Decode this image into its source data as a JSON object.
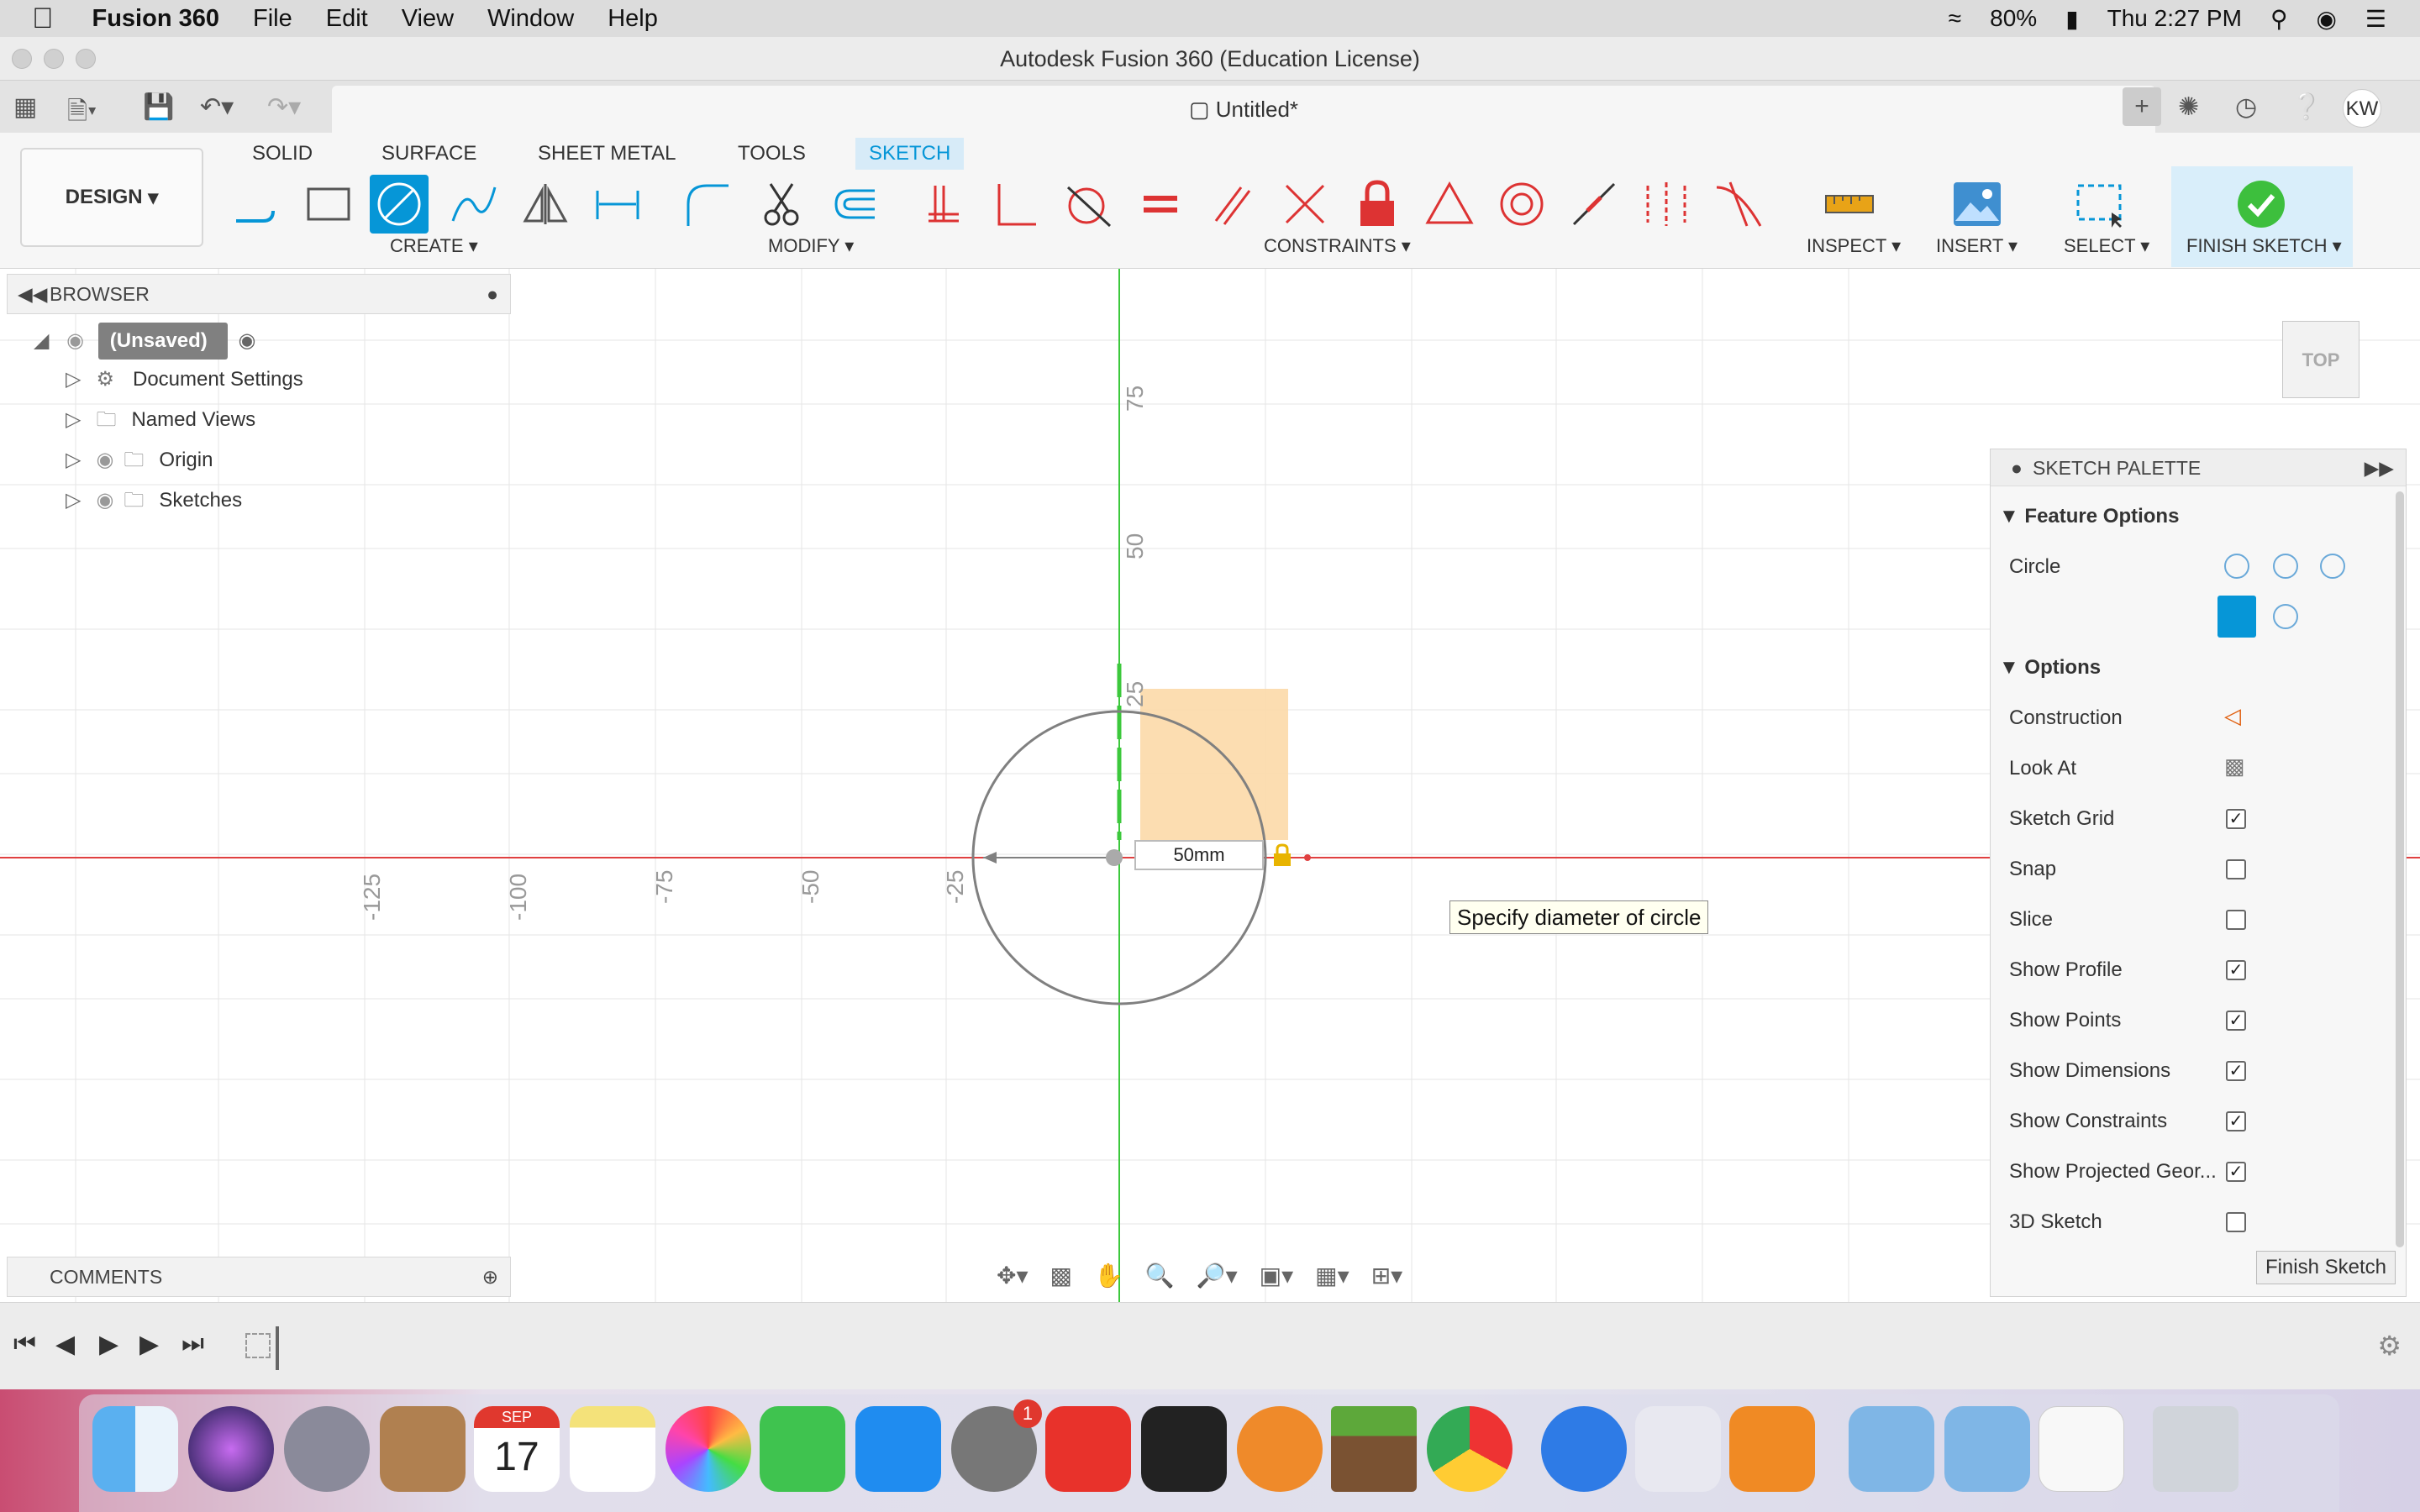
{
  "menubar": {
    "app_name": "Fusion 360",
    "items": [
      "File",
      "Edit",
      "View",
      "Window",
      "Help"
    ],
    "battery": "80%",
    "clock": "Thu 2:27 PM",
    "user_initials": "KW"
  },
  "window": {
    "title": "Autodesk Fusion 360 (Education License)",
    "doc_tab": "Untitled*"
  },
  "ribbon": {
    "workspace": "DESIGN",
    "tabs": [
      "SOLID",
      "SURFACE",
      "SHEET METAL",
      "TOOLS",
      "SKETCH"
    ],
    "active_tab": "SKETCH",
    "groups": {
      "create": "CREATE",
      "modify": "MODIFY",
      "constraints": "CONSTRAINTS",
      "inspect": "INSPECT",
      "insert": "INSERT",
      "select": "SELECT",
      "finish": "FINISH SKETCH"
    }
  },
  "browser": {
    "header": "BROWSER",
    "root": "(Unsaved)",
    "items": [
      "Document Settings",
      "Named Views",
      "Origin",
      "Sketches"
    ]
  },
  "canvas": {
    "x_ticks": [
      "-125",
      "-100",
      "-75",
      "-50",
      "-25"
    ],
    "y_ticks": [
      "75",
      "50",
      "25"
    ],
    "dimension_value": "50mm",
    "tooltip": "Specify diameter of circle",
    "viewcube_label": "TOP"
  },
  "palette": {
    "title": "SKETCH PALETTE",
    "feature_options": "Feature Options",
    "circle_label": "Circle",
    "options": "Options",
    "rows": [
      {
        "label": "Construction",
        "kind": "icon"
      },
      {
        "label": "Look At",
        "kind": "icon"
      },
      {
        "label": "Sketch Grid",
        "checked": true
      },
      {
        "label": "Snap",
        "checked": false
      },
      {
        "label": "Slice",
        "checked": false
      },
      {
        "label": "Show Profile",
        "checked": true
      },
      {
        "label": "Show Points",
        "checked": true
      },
      {
        "label": "Show Dimensions",
        "checked": true
      },
      {
        "label": "Show Constraints",
        "checked": true
      },
      {
        "label": "Show Projected Geor...",
        "checked": true
      },
      {
        "label": "3D Sketch",
        "checked": false
      }
    ],
    "finish_button": "Finish Sketch"
  },
  "comments": {
    "header": "COMMENTS"
  },
  "dock": {
    "calendar_month": "SEP",
    "calendar_day": "17",
    "badge": "1"
  },
  "colors": {
    "accent": "#0696d7",
    "x_axis": "#e04040",
    "y_axis": "#3cc83c",
    "profile_fill": "#fcd9a8"
  }
}
